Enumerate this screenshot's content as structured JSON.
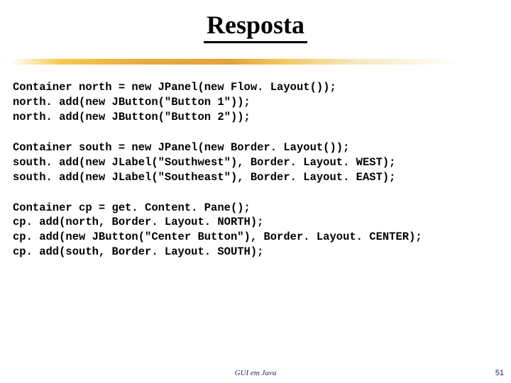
{
  "title": "Resposta",
  "code": {
    "block1": {
      "l1": "Container north = new JPanel(new Flow. Layout());",
      "l2": "north. add(new JButton(\"Button 1\"));",
      "l3": "north. add(new JButton(\"Button 2\"));"
    },
    "block2": {
      "l1": "Container south = new JPanel(new Border. Layout());",
      "l2": "south. add(new JLabel(\"Southwest\"), Border. Layout. WEST);",
      "l3": "south. add(new JLabel(\"Southeast\"), Border. Layout. EAST);"
    },
    "block3": {
      "l1": "Container cp = get. Content. Pane();",
      "l2": "cp. add(north, Border. Layout. NORTH);",
      "l3": "cp. add(new JButton(\"Center Button\"), Border. Layout. CENTER);",
      "l4": "cp. add(south, Border. Layout. SOUTH);"
    }
  },
  "footer": {
    "text": "GUI em Java",
    "page": "51"
  }
}
